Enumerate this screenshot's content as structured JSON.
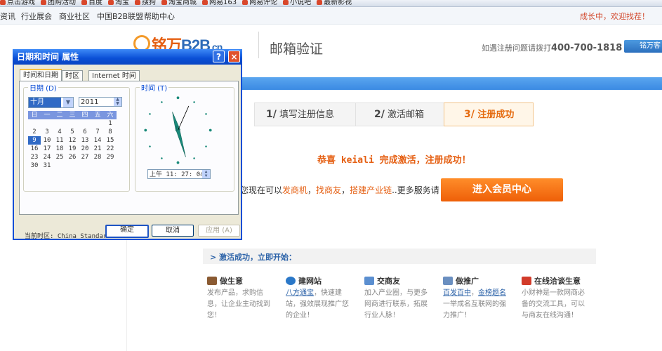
{
  "favorites": [
    "点击游戏",
    "团购活动",
    "百度",
    "淘宝",
    "搜狗",
    "淘宝商城",
    "网易163",
    "网易评论",
    "小说吧",
    "最新影视"
  ],
  "topnav": {
    "items": [
      "资讯",
      "行业展会",
      "商业社区",
      "中国B2B联盟",
      "帮助中心"
    ],
    "welcome": "成长中，欢迎找茬！"
  },
  "header": {
    "logo_text": "铭万",
    "logo_b2b": "B2B",
    "logo_cn": ".cn",
    "page_title": "邮箱验证",
    "hotline_label": "如遇注册问题请拨打",
    "hotline_number": "400-700-1818",
    "service_button": "铭万客"
  },
  "steps": [
    {
      "num": "1/",
      "label": "填写注册信息"
    },
    {
      "num": "2/",
      "label": "激活邮箱"
    },
    {
      "num": "3/",
      "label": "注册成功"
    }
  ],
  "main": {
    "congrats": "恭喜 keiali 完成激活，注册成功！",
    "services_prefix": "您现在可以",
    "service_a": "发商机",
    "service_b": "找商友",
    "service_c": "搭建产业链",
    "services_suffix": "..更多服务请",
    "enter_button": "进入会员中心",
    "start_strip": "> 激活成功，立即开始："
  },
  "cards": [
    {
      "title": "做生意",
      "lines": [
        "发布产品，求购信",
        "息，让企业主动找到",
        "您！"
      ],
      "color": "#8a5a32"
    },
    {
      "title": "建网站",
      "link": "八方通宝",
      "lines": [
        "，快速建",
        "站，强效展现推广您",
        "的企业！"
      ],
      "color": "#2b78c8"
    },
    {
      "title": "交商友",
      "lines": [
        "加入产业圈，与更多",
        "网商进行联系，拓展",
        "行业人脉！"
      ],
      "color": "#5b8fd0"
    },
    {
      "title": "做推广",
      "link": "百发百中",
      "link2": "金榜题名",
      "lines": [
        "一举成名互联网的强",
        "力推广！"
      ],
      "color": "#6a8fc0"
    },
    {
      "title": "在线洽谈生意",
      "lines": [
        "小财神是一款网商必",
        "备的交流工具，可以",
        "与商友在线沟通！"
      ],
      "color": "#d23b2a"
    }
  ],
  "dialog": {
    "title": "日期和时间 属性",
    "help": "?",
    "close": "×",
    "tabs": [
      "时间和日期",
      "时区",
      "Internet 时间"
    ],
    "date_group": "日期 (D)",
    "time_group": "时间 (T)",
    "month": "十月",
    "year": "2011",
    "weekdays": [
      "日",
      "一",
      "二",
      "三",
      "四",
      "五",
      "六"
    ],
    "weeks": [
      [
        "",
        "",
        "",
        "",
        "",
        "",
        "1"
      ],
      [
        "2",
        "3",
        "4",
        "5",
        "6",
        "7",
        "8"
      ],
      [
        "9",
        "10",
        "11",
        "12",
        "13",
        "14",
        "15"
      ],
      [
        "16",
        "17",
        "18",
        "19",
        "20",
        "21",
        "22"
      ],
      [
        "23",
        "24",
        "25",
        "26",
        "27",
        "28",
        "29"
      ],
      [
        "30",
        "31",
        "",
        "",
        "",
        "",
        ""
      ]
    ],
    "selected_day": "9",
    "time": "上午  11: 27: 04",
    "timezone": "当前时区: China Standard Time",
    "ok": "确定",
    "cancel": "取消",
    "apply": "应用 (A)"
  }
}
